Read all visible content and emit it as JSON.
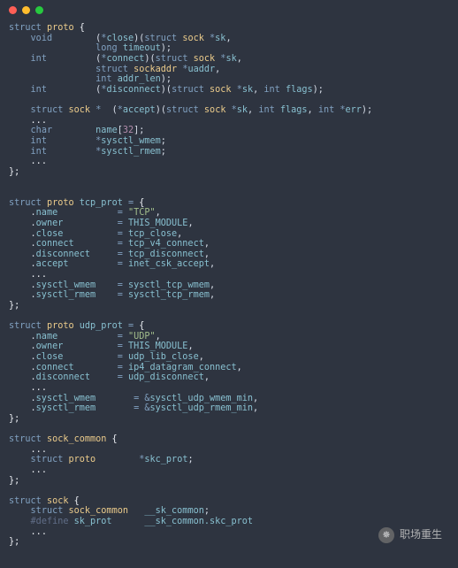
{
  "chart_data": {
    "type": "table",
    "title": "C source: struct proto / tcp_prot / udp_prot / sock_common / sock"
  },
  "watermark": {
    "label": "职场重生"
  },
  "code": {
    "l1": {
      "kw1": "struct",
      "id1": "proto",
      "pun": " {"
    },
    "l2": {
      "kw1": "void",
      "field": "close",
      "kw2": "struct",
      "id2": "sock",
      "arg": "sk"
    },
    "l3": {
      "kw1": "long",
      "arg": "timeout"
    },
    "l4": {
      "kw1": "int",
      "field": "connect",
      "kw2": "struct",
      "id2": "sock",
      "arg": "sk"
    },
    "l5": {
      "kw2": "struct",
      "id2": "sockaddr",
      "arg": "uaddr"
    },
    "l6": {
      "kw1": "int",
      "arg": "addr_len"
    },
    "l7": {
      "kw1": "int",
      "field": "disconnect",
      "kw2": "struct",
      "id2": "sock",
      "arg": "sk",
      "kw3": "int",
      "arg2": "flags"
    },
    "l8": {
      "kw1": "struct",
      "id1": "sock",
      "field": "accept",
      "kw2": "struct",
      "id2": "sock",
      "arg": "sk",
      "kw3": "int",
      "arg2": "flags",
      "kw4": "int",
      "arg3": "err"
    },
    "l9": {
      "ell": "..."
    },
    "l10": {
      "kw1": "char",
      "field": "name",
      "num": "32"
    },
    "l11": {
      "kw1": "int",
      "field": "sysctl_wmem"
    },
    "l12": {
      "kw1": "int",
      "field": "sysctl_rmem"
    },
    "l13": {
      "ell": "..."
    },
    "l14": {
      "pun": "};"
    },
    "l16": {
      "kw1": "struct",
      "id1": "proto",
      "field": "tcp_prot"
    },
    "l17": {
      "f": "name",
      "v": "\"TCP\""
    },
    "l18": {
      "f": "owner",
      "v": "THIS_MODULE"
    },
    "l19": {
      "f": "close",
      "v": "tcp_close"
    },
    "l20": {
      "f": "connect",
      "v": "tcp_v4_connect"
    },
    "l21": {
      "f": "disconnect",
      "v": "tcp_disconnect"
    },
    "l22": {
      "f": "accept",
      "v": "inet_csk_accept"
    },
    "l23": {
      "ell": "..."
    },
    "l24": {
      "f": "sysctl_wmem",
      "v": "sysctl_tcp_wmem"
    },
    "l25": {
      "f": "sysctl_rmem",
      "v": "sysctl_tcp_rmem"
    },
    "l26": {
      "pun": "};"
    },
    "l28": {
      "kw1": "struct",
      "id1": "proto",
      "field": "udp_prot"
    },
    "l29": {
      "f": "name",
      "v": "\"UDP\""
    },
    "l30": {
      "f": "owner",
      "v": "THIS_MODULE"
    },
    "l31": {
      "f": "close",
      "v": "udp_lib_close"
    },
    "l32": {
      "f": "connect",
      "v": "ip4_datagram_connect"
    },
    "l33": {
      "f": "disconnect",
      "v": "udp_disconnect"
    },
    "l34": {
      "ell": "..."
    },
    "l35": {
      "f": "sysctl_wmem",
      "v": "sysctl_udp_wmem_min"
    },
    "l36": {
      "f": "sysctl_rmem",
      "v": "sysctl_udp_rmem_min"
    },
    "l37": {
      "pun": "};"
    },
    "l39": {
      "kw1": "struct",
      "id1": "sock_common",
      "pun": " {"
    },
    "l40": {
      "ell": "..."
    },
    "l41": {
      "kw1": "struct",
      "id1": "proto",
      "field": "skc_prot"
    },
    "l42": {
      "ell": "..."
    },
    "l43": {
      "pun": "};"
    },
    "l45": {
      "kw1": "struct",
      "id1": "sock",
      "pun": " {"
    },
    "l46": {
      "kw1": "struct",
      "id1": "sock_common",
      "field": "__sk_common"
    },
    "l47": {
      "def": "#define",
      "a": "sk_prot",
      "b": "__sk_common.skc_prot"
    },
    "l48": {
      "ell": "..."
    },
    "l49": {
      "pun": "};"
    }
  }
}
